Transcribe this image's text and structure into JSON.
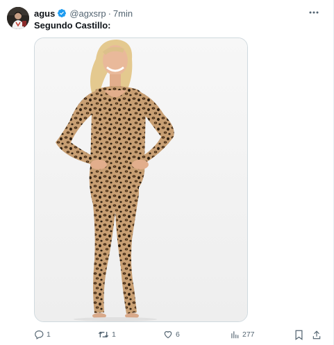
{
  "tweet": {
    "author_name": "agus",
    "handle": "@agxsrp",
    "separator": "·",
    "time": "7min",
    "text": "Segundo Castillo:",
    "verified": true
  },
  "icons": {
    "avatar": "user-avatar",
    "verified": "verified-badge-icon",
    "more": "more-dots-icon",
    "reply": "reply-icon",
    "retweet": "retweet-icon",
    "like": "heart-icon",
    "views": "views-bar-icon",
    "bookmark": "bookmark-icon",
    "share": "share-icon"
  },
  "media": {
    "description_icon": "photo-of-woman-in-leopard-bodysuit"
  },
  "actions": {
    "reply_count": "1",
    "retweet_count": "1",
    "like_count": "6",
    "views_count": "277"
  },
  "colors": {
    "text_primary": "#0f1419",
    "text_secondary": "#536471",
    "verified_blue": "#1d9bf0",
    "border": "#cfd9de"
  }
}
